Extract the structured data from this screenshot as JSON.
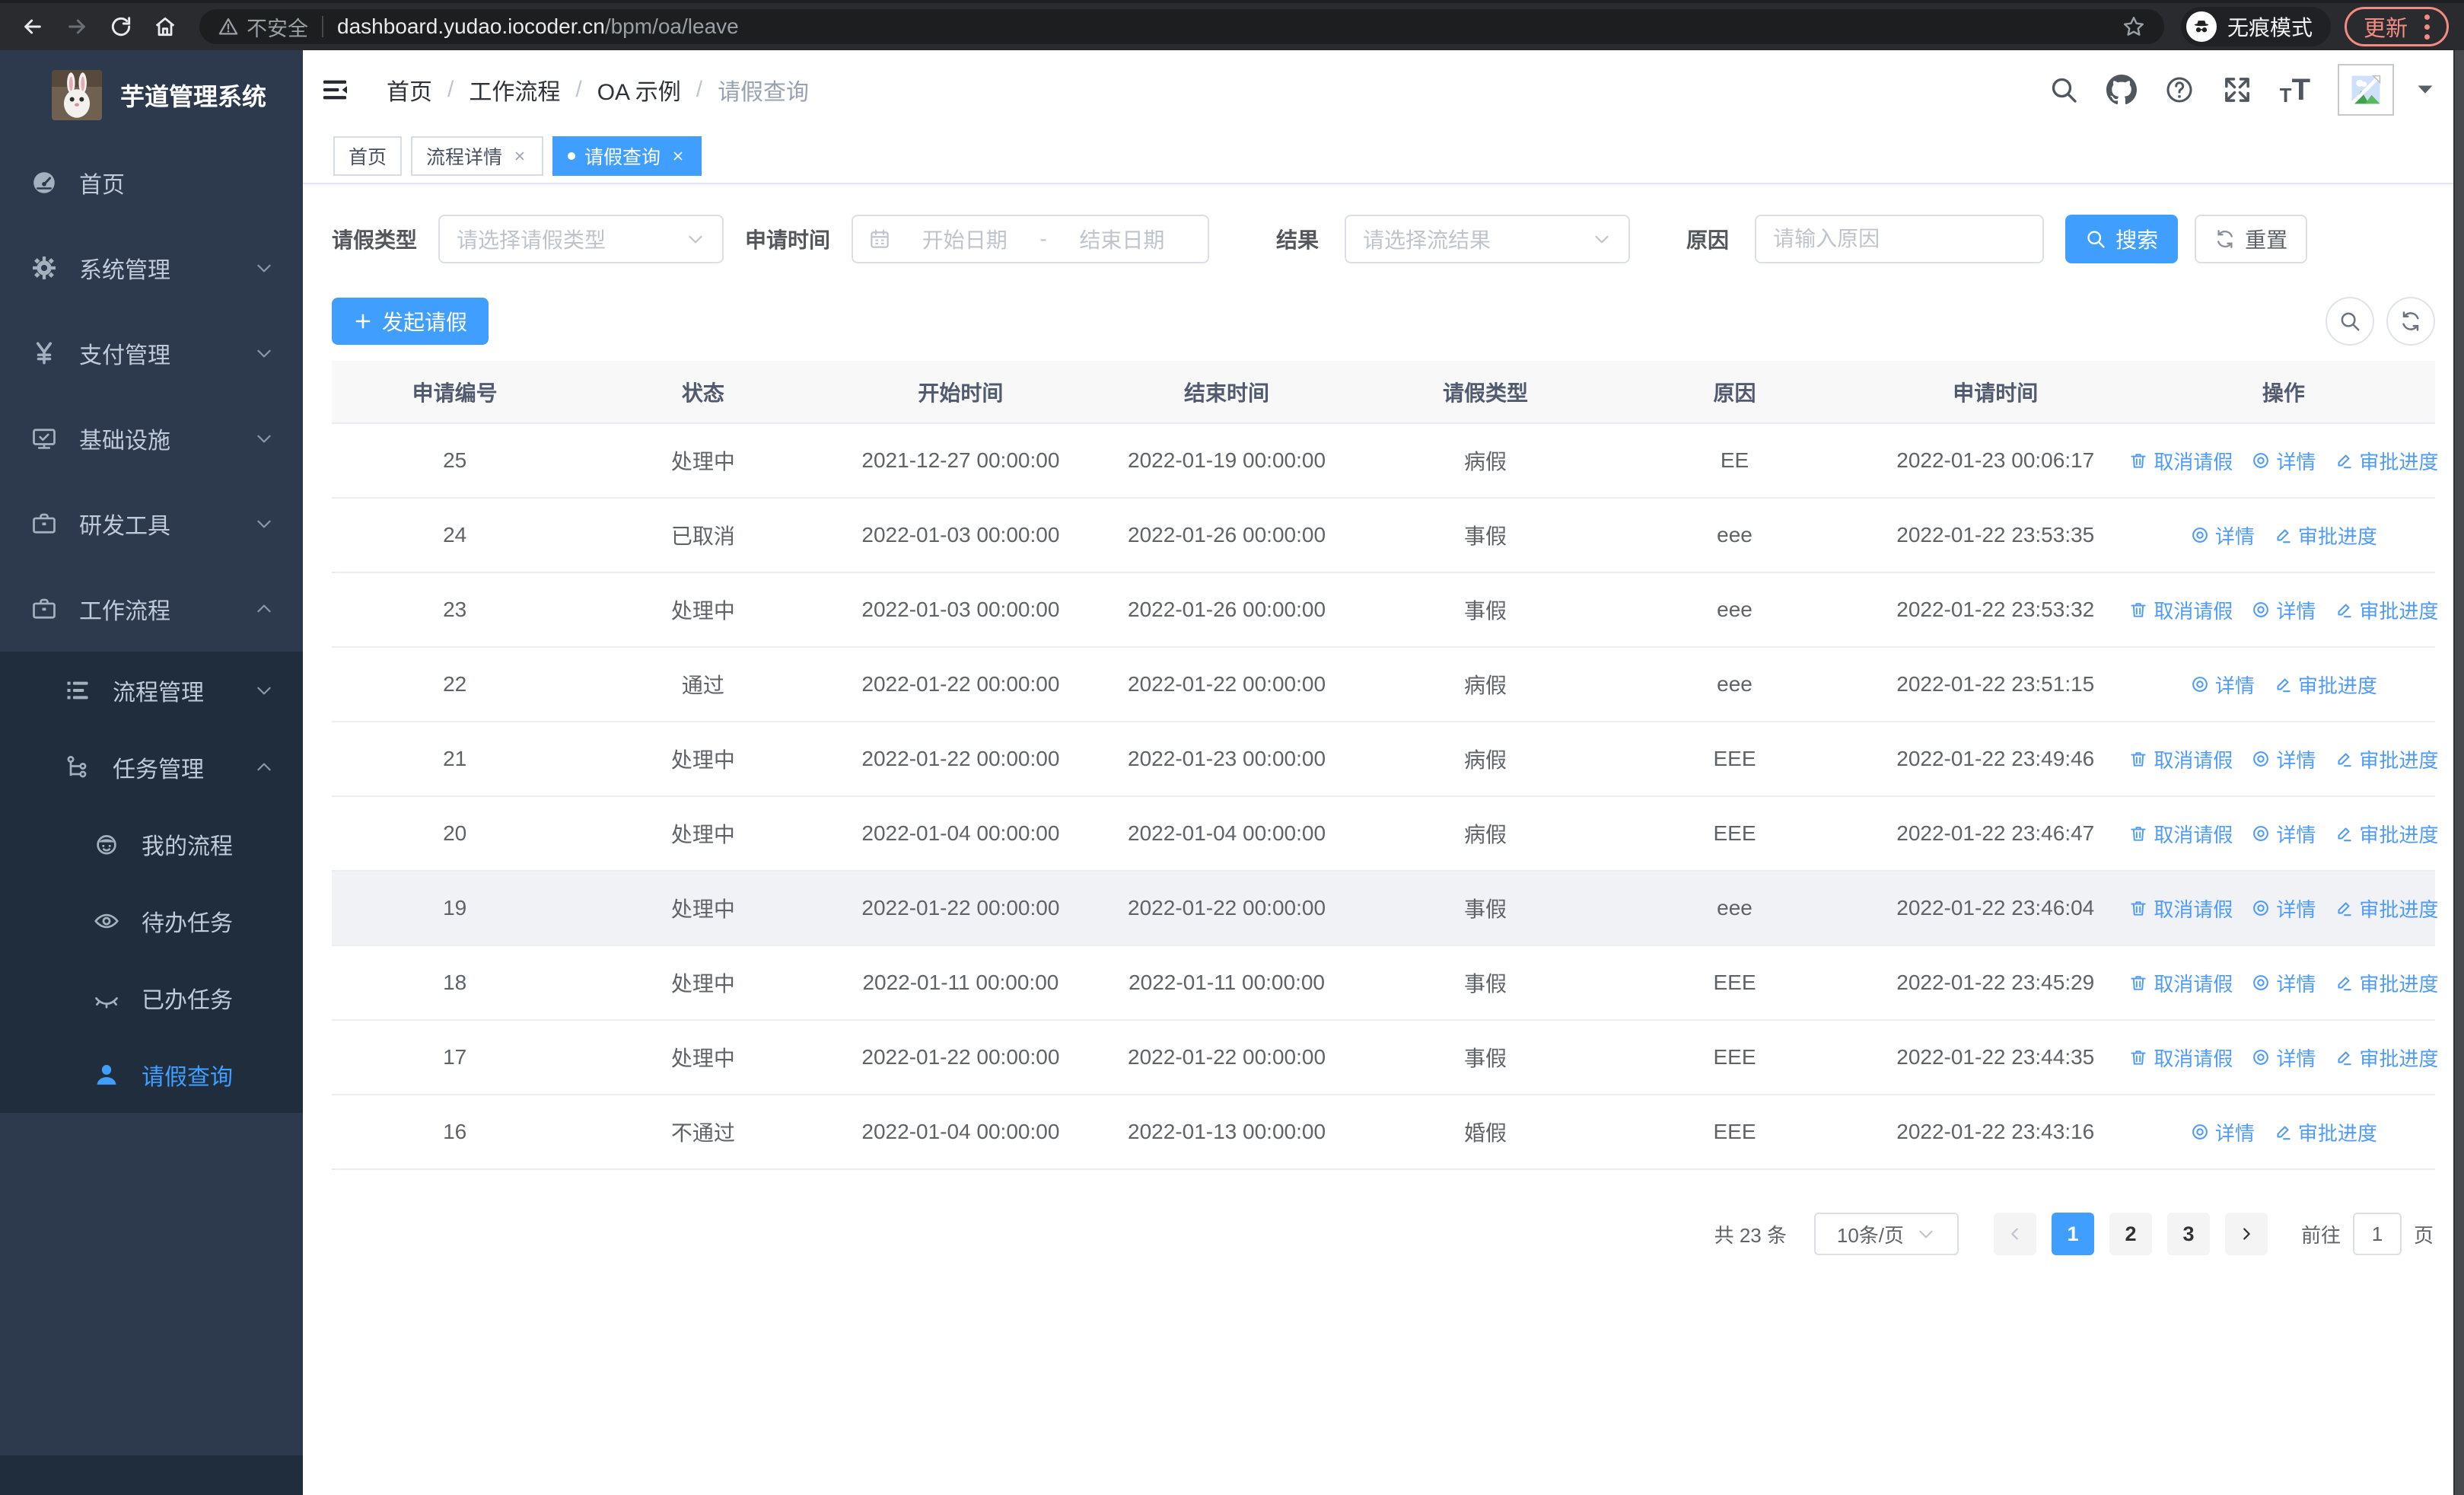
{
  "browser": {
    "security_label": "不安全",
    "url_host": "dashboard.yudao.iocoder.cn",
    "url_path": "/bpm/oa/leave",
    "incognito_label": "无痕模式",
    "update_label": "更新"
  },
  "sidebar": {
    "title": "芋道管理系统",
    "items": [
      {
        "label": "首页",
        "icon": "dashboard",
        "level": 0,
        "chevron": "",
        "active": false,
        "dark": false
      },
      {
        "label": "系统管理",
        "icon": "gear",
        "level": 0,
        "chevron": "down",
        "active": false,
        "dark": false
      },
      {
        "label": "支付管理",
        "icon": "yen",
        "level": 0,
        "chevron": "down",
        "active": false,
        "dark": false
      },
      {
        "label": "基础设施",
        "icon": "monitor",
        "level": 0,
        "chevron": "down",
        "active": false,
        "dark": false
      },
      {
        "label": "研发工具",
        "icon": "briefcase",
        "level": 0,
        "chevron": "down",
        "active": false,
        "dark": false
      },
      {
        "label": "工作流程",
        "icon": "briefcase",
        "level": 0,
        "chevron": "up",
        "active": false,
        "dark": false
      },
      {
        "label": "流程管理",
        "icon": "flow-list",
        "level": 1,
        "chevron": "down",
        "active": false,
        "dark": true
      },
      {
        "label": "任务管理",
        "icon": "task-tree",
        "level": 1,
        "chevron": "up",
        "active": false,
        "dark": true
      },
      {
        "label": "我的流程",
        "icon": "robot",
        "level": 2,
        "chevron": "",
        "active": false,
        "dark": true
      },
      {
        "label": "待办任务",
        "icon": "eye-open",
        "level": 2,
        "chevron": "",
        "active": false,
        "dark": true
      },
      {
        "label": "已办任务",
        "icon": "eye-closed",
        "level": 2,
        "chevron": "",
        "active": false,
        "dark": true
      },
      {
        "label": "请假查询",
        "icon": "user",
        "level": 2,
        "chevron": "",
        "active": true,
        "dark": true
      }
    ]
  },
  "header": {
    "breadcrumb": [
      "首页",
      "工作流程",
      "OA 示例",
      "请假查询"
    ],
    "font_size_icon_small": "T",
    "font_size_icon_large": "T"
  },
  "tabs": [
    {
      "label": "首页",
      "closable": false,
      "active": false
    },
    {
      "label": "流程详情",
      "closable": true,
      "active": false
    },
    {
      "label": "请假查询",
      "closable": true,
      "active": true
    }
  ],
  "filters": {
    "leave_type": {
      "label": "请假类型",
      "placeholder": "请选择请假类型"
    },
    "apply_time": {
      "label": "申请时间",
      "start_placeholder": "开始日期",
      "separator": "-",
      "end_placeholder": "结束日期"
    },
    "result": {
      "label": "结果",
      "placeholder": "请选择流结果"
    },
    "reason": {
      "label": "原因",
      "placeholder": "请输入原因"
    },
    "search_label": "搜索",
    "reset_label": "重置"
  },
  "toolbar": {
    "create_label": "发起请假"
  },
  "table": {
    "columns": [
      "申请编号",
      "状态",
      "开始时间",
      "结束时间",
      "请假类型",
      "原因",
      "申请时间",
      "操作"
    ],
    "action_labels": {
      "cancel": "取消请假",
      "detail": "详情",
      "progress": "审批进度"
    },
    "rows": [
      {
        "id": "25",
        "status": "处理中",
        "start": "2021-12-27 00:00:00",
        "end": "2022-01-19 00:00:00",
        "type": "病假",
        "reason": "EE",
        "applied": "2022-01-23 00:06:17",
        "cancelable": true,
        "highlight": false
      },
      {
        "id": "24",
        "status": "已取消",
        "start": "2022-01-03 00:00:00",
        "end": "2022-01-26 00:00:00",
        "type": "事假",
        "reason": "eee",
        "applied": "2022-01-22 23:53:35",
        "cancelable": false,
        "highlight": false
      },
      {
        "id": "23",
        "status": "处理中",
        "start": "2022-01-03 00:00:00",
        "end": "2022-01-26 00:00:00",
        "type": "事假",
        "reason": "eee",
        "applied": "2022-01-22 23:53:32",
        "cancelable": true,
        "highlight": false
      },
      {
        "id": "22",
        "status": "通过",
        "start": "2022-01-22 00:00:00",
        "end": "2022-01-22 00:00:00",
        "type": "病假",
        "reason": "eee",
        "applied": "2022-01-22 23:51:15",
        "cancelable": false,
        "highlight": false
      },
      {
        "id": "21",
        "status": "处理中",
        "start": "2022-01-22 00:00:00",
        "end": "2022-01-23 00:00:00",
        "type": "病假",
        "reason": "EEE",
        "applied": "2022-01-22 23:49:46",
        "cancelable": true,
        "highlight": false
      },
      {
        "id": "20",
        "status": "处理中",
        "start": "2022-01-04 00:00:00",
        "end": "2022-01-04 00:00:00",
        "type": "病假",
        "reason": "EEE",
        "applied": "2022-01-22 23:46:47",
        "cancelable": true,
        "highlight": false
      },
      {
        "id": "19",
        "status": "处理中",
        "start": "2022-01-22 00:00:00",
        "end": "2022-01-22 00:00:00",
        "type": "事假",
        "reason": "eee",
        "applied": "2022-01-22 23:46:04",
        "cancelable": true,
        "highlight": true
      },
      {
        "id": "18",
        "status": "处理中",
        "start": "2022-01-11 00:00:00",
        "end": "2022-01-11 00:00:00",
        "type": "事假",
        "reason": "EEE",
        "applied": "2022-01-22 23:45:29",
        "cancelable": true,
        "highlight": false
      },
      {
        "id": "17",
        "status": "处理中",
        "start": "2022-01-22 00:00:00",
        "end": "2022-01-22 00:00:00",
        "type": "事假",
        "reason": "EEE",
        "applied": "2022-01-22 23:44:35",
        "cancelable": true,
        "highlight": false
      },
      {
        "id": "16",
        "status": "不通过",
        "start": "2022-01-04 00:00:00",
        "end": "2022-01-13 00:00:00",
        "type": "婚假",
        "reason": "EEE",
        "applied": "2022-01-22 23:43:16",
        "cancelable": false,
        "highlight": false
      }
    ]
  },
  "pagination": {
    "total_label": "共 23 条",
    "page_size_label": "10条/页",
    "pages": [
      "1",
      "2",
      "3"
    ],
    "active_page": "1",
    "goto_label": "前往",
    "goto_value": "1",
    "page_unit": "页"
  },
  "colors": {
    "accent": "#409eff",
    "sidebar_bg": "#2d3a4d",
    "sidebar_sub_bg": "#1f2d3d",
    "action_link": "#4f9bfa",
    "update_chip": "#f28b82"
  }
}
